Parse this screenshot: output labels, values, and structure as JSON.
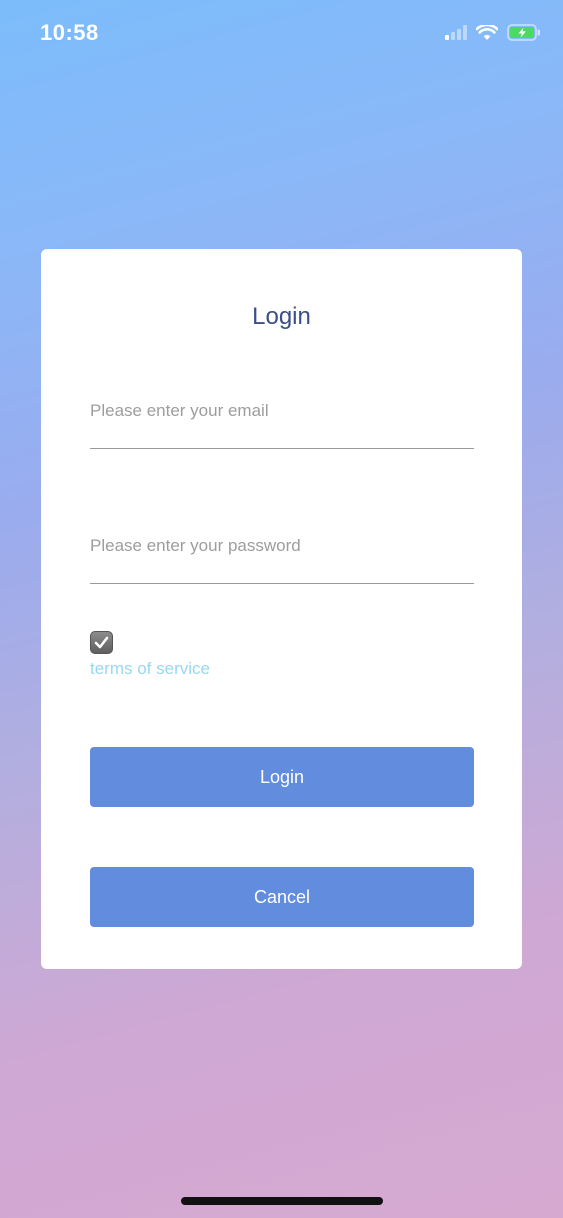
{
  "status_bar": {
    "time": "10:58",
    "icons": [
      "cellular-signal-icon",
      "wifi-icon",
      "battery-charging-icon"
    ]
  },
  "login_card": {
    "title": "Login",
    "email_placeholder": "Please enter your email",
    "email_value": "",
    "password_placeholder": "Please enter your password",
    "password_value": "",
    "terms_checked": true,
    "terms_label": "terms of service",
    "login_button": "Login",
    "cancel_button": "Cancel"
  },
  "colors": {
    "button": "#628ddf",
    "title": "#3c4f86",
    "link": "#9ad7ef",
    "battery_fill": "#4cd964"
  }
}
